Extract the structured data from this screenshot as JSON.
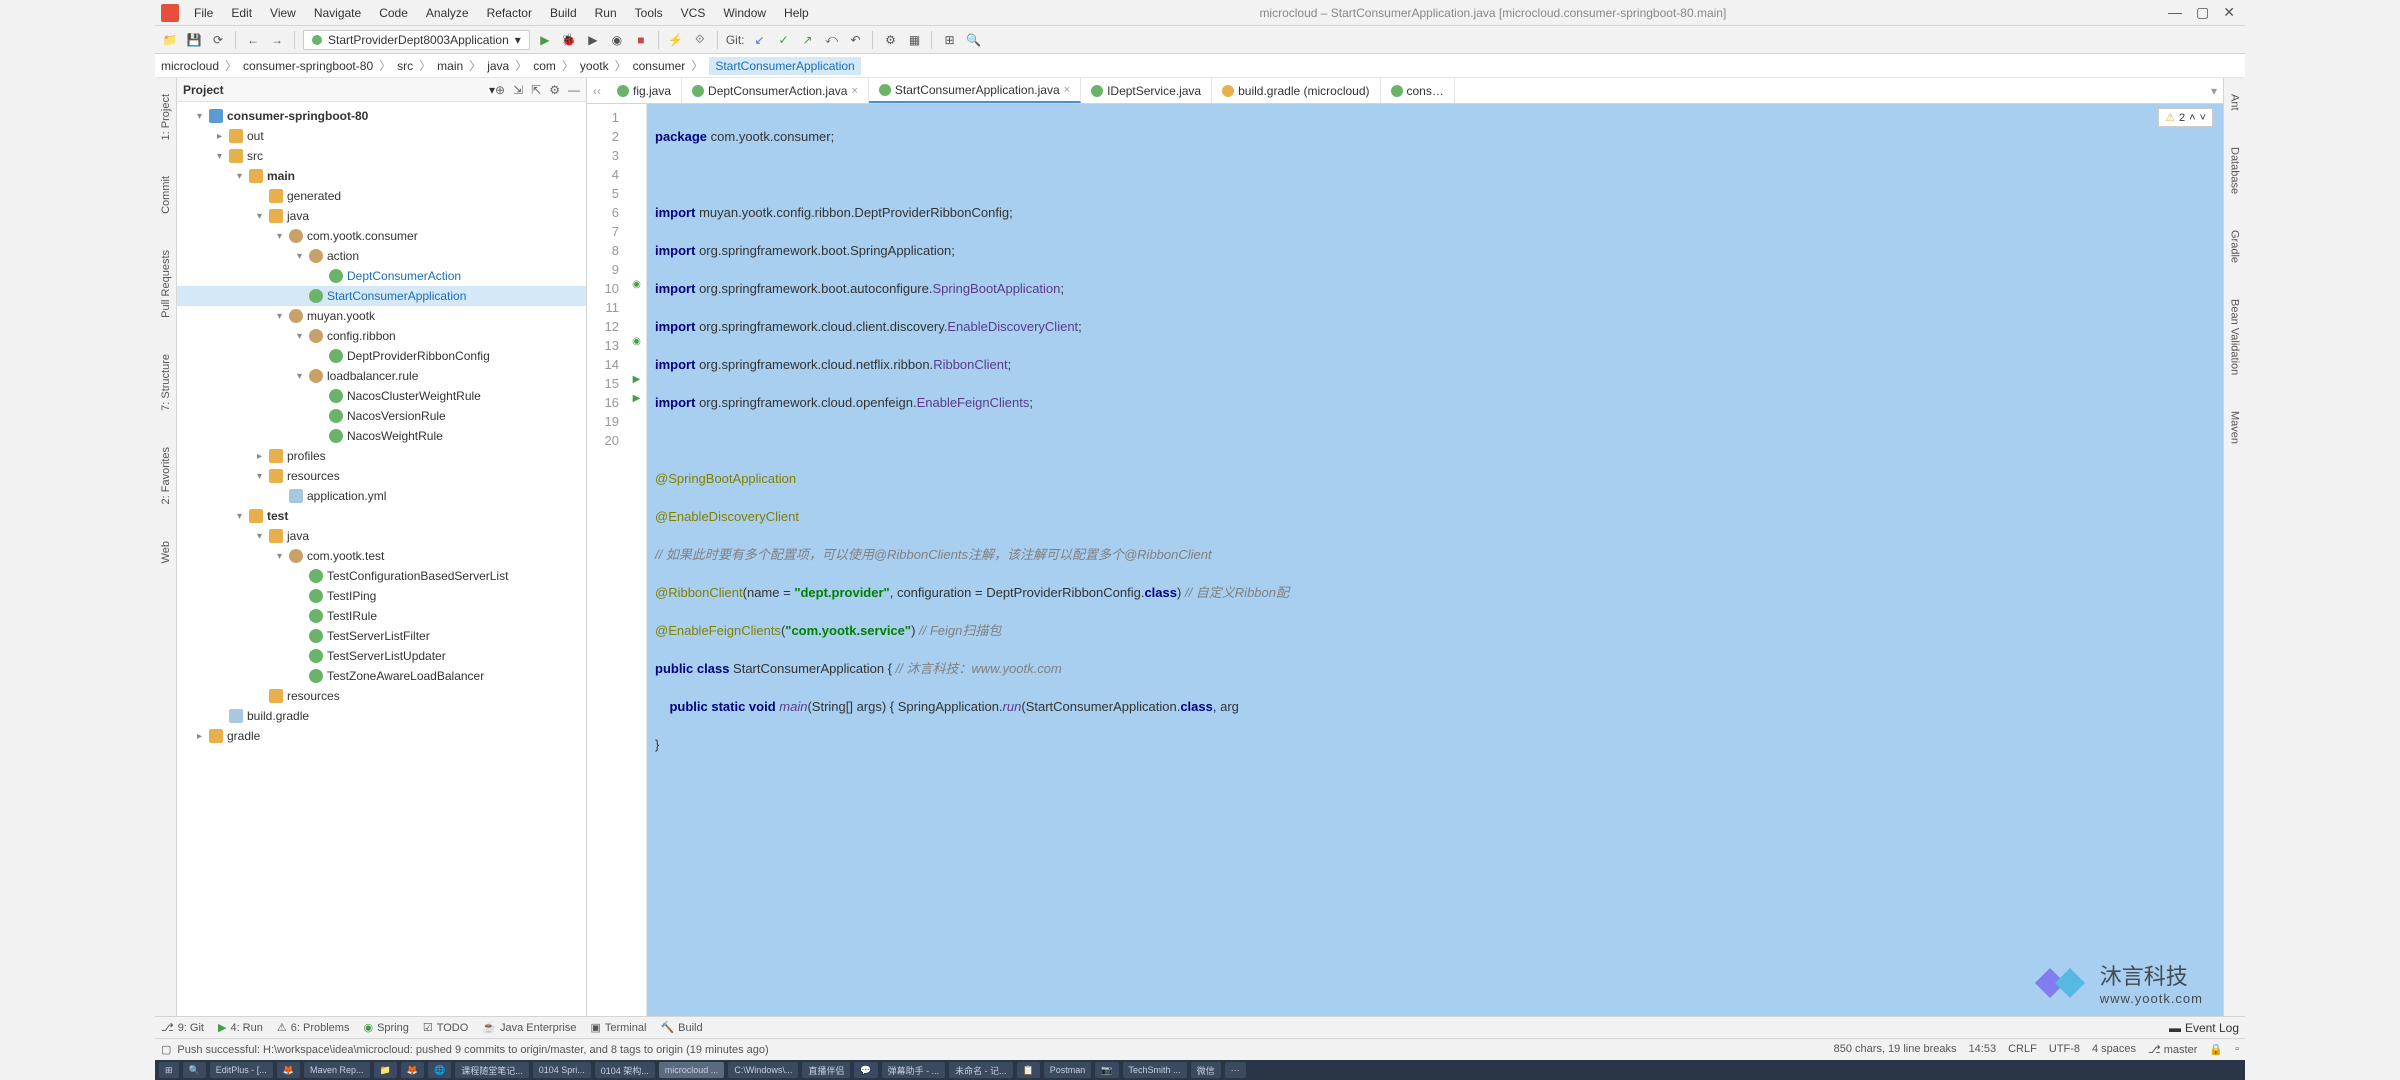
{
  "window": {
    "title": "microcloud – StartConsumerApplication.java [microcloud.consumer-springboot-80.main]"
  },
  "menu": [
    "File",
    "Edit",
    "View",
    "Navigate",
    "Code",
    "Analyze",
    "Refactor",
    "Build",
    "Run",
    "Tools",
    "VCS",
    "Window",
    "Help"
  ],
  "run_config": "StartProviderDept8003Application",
  "git_label": "Git:",
  "breadcrumbs": [
    "microcloud",
    "consumer-springboot-80",
    "src",
    "main",
    "java",
    "com",
    "yootk",
    "consumer",
    "StartConsumerApplication"
  ],
  "project_panel": {
    "title": "Project"
  },
  "tree": {
    "root": "consumer-springboot-80",
    "out": "out",
    "src": "src",
    "main": "main",
    "generated": "generated",
    "java": "java",
    "pkg_consumer": "com.yootk.consumer",
    "action": "action",
    "DeptConsumerAction": "DeptConsumerAction",
    "StartConsumerApplication": "StartConsumerApplication",
    "muyan_yootk": "muyan.yootk",
    "config_ribbon": "config.ribbon",
    "DeptProviderRibbonConfig": "DeptProviderRibbonConfig",
    "loadbalancer_rule": "loadbalancer.rule",
    "NacosClusterWeightRule": "NacosClusterWeightRule",
    "NacosVersionRule": "NacosVersionRule",
    "NacosWeightRule": "NacosWeightRule",
    "profiles": "profiles",
    "resources": "resources",
    "application_yml": "application.yml",
    "test": "test",
    "test_java": "java",
    "pkg_test": "com.yootk.test",
    "TestConfigurationBasedServerList": "TestConfigurationBasedServerList",
    "TestIPing": "TestIPing",
    "TestIRule": "TestIRule",
    "TestServerListFilter": "TestServerListFilter",
    "TestServerListUpdater": "TestServerListUpdater",
    "TestZoneAwareLoadBalancer": "TestZoneAwareLoadBalancer",
    "test_resources": "resources",
    "build_gradle": "build.gradle",
    "gradle": "gradle"
  },
  "editor_tabs": [
    {
      "label": "fig.java",
      "active": false
    },
    {
      "label": "DeptConsumerAction.java",
      "active": false
    },
    {
      "label": "StartConsumerApplication.java",
      "active": true
    },
    {
      "label": "IDeptService.java",
      "active": false
    },
    {
      "label": "build.gradle (microcloud)",
      "active": false
    },
    {
      "label": "cons…",
      "active": false
    }
  ],
  "inspection": {
    "count": "2"
  },
  "code_lines": [
    "package com.yootk.consumer;",
    "",
    "import muyan.yootk.config.ribbon.DeptProviderRibbonConfig;",
    "import org.springframework.boot.SpringApplication;",
    "import org.springframework.boot.autoconfigure.SpringBootApplication;",
    "import org.springframework.cloud.client.discovery.EnableDiscoveryClient;",
    "import org.springframework.cloud.netflix.ribbon.RibbonClient;",
    "import org.springframework.cloud.openfeign.EnableFeignClients;",
    "",
    "@SpringBootApplication",
    "@EnableDiscoveryClient",
    "// 如果此时要有多个配置项，可以使用@RibbonClients注解，该注解可以配置多个@RibbonClient",
    "@RibbonClient(name = \"dept.provider\", configuration = DeptProviderRibbonConfig.class) // 自定义Ribbon配",
    "@EnableFeignClients(\"com.yootk.service\") // Feign扫描包",
    "public class StartConsumerApplication { // 沐言科技：www.yootk.com",
    "    public static void main(String[] args) { SpringApplication.run(StartConsumerApplication.class, arg",
    "}",
    ""
  ],
  "line_numbers": [
    "1",
    "2",
    "3",
    "4",
    "5",
    "6",
    "7",
    "8",
    "9",
    "10",
    "11",
    "12",
    "13",
    "14",
    "15",
    "16",
    "19",
    "20"
  ],
  "watermark": {
    "brand": "沐言科技",
    "url": "www.yootk.com"
  },
  "left_gutter": [
    "1: Project",
    "Commit",
    "Pull Requests",
    "7: Structure",
    "2: Favorites",
    "Web"
  ],
  "right_gutter": [
    "Ant",
    "Database",
    "Gradle",
    "Bean Validation",
    "Maven"
  ],
  "bottom_tabs": [
    {
      "label": "9: Git"
    },
    {
      "label": "4: Run"
    },
    {
      "label": "6: Problems"
    },
    {
      "label": "Spring"
    },
    {
      "label": "TODO"
    },
    {
      "label": "Java Enterprise"
    },
    {
      "label": "Terminal"
    },
    {
      "label": "Build"
    }
  ],
  "event_log": "Event Log",
  "status": {
    "message": "Push successful: H:\\workspace\\idea\\microcloud: pushed 9 commits to origin/master, and 8 tags to origin (19 minutes ago)",
    "chars": "850 chars, 19 line breaks",
    "pos": "14:53",
    "eol": "CRLF",
    "enc": "UTF-8",
    "indent": "4 spaces",
    "branch": "master"
  },
  "taskbar": [
    "",
    "",
    "EditPlus - [...",
    "",
    "Maven Rep...",
    "",
    "",
    "",
    "课程随堂笔记...",
    "0104 Spri...",
    "0104 架构...",
    "microcloud ...",
    "C:\\Windows\\...",
    "直播伴侣",
    "",
    "弹幕助手 - ...",
    "未命名 - 记...",
    "",
    "Postman",
    "",
    "TechSmith ...",
    "微信",
    ""
  ]
}
